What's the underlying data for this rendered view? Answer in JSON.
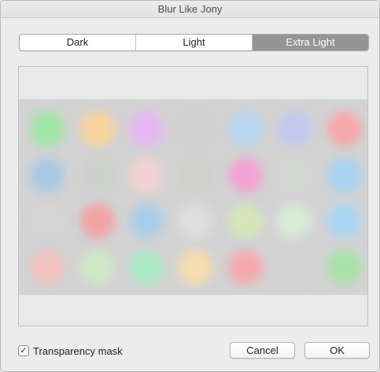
{
  "window": {
    "title": "Blur Like Jony"
  },
  "segments": [
    {
      "label": "Dark",
      "selected": false
    },
    {
      "label": "Light",
      "selected": false
    },
    {
      "label": "Extra Light",
      "selected": true
    }
  ],
  "colors": {
    "selected_segment": "#949494",
    "preview_background": "#d3d3d3",
    "icon_colors": [
      "#9ee6a4",
      "#f7d49a",
      "#e6b7f3",
      "#d0d0d0",
      "#b6d6f0",
      "#c1c9ef",
      "#f6a7a9",
      "#a9c9e4",
      "#ccd0cc",
      "#f3d1d1",
      "#cfd0c9",
      "#f2a3d1",
      "#d2d7d2",
      "#a6d2f0",
      "#d4d4d4",
      "#f2a3a6",
      "#a9cde8",
      "#dedede",
      "#d5e6b9",
      "#d9ebd7",
      "#a9d6f3",
      "#f3c1c1",
      "#cde9c4",
      "#a9eac6",
      "#f6dcae",
      "#f3a9ad",
      "#d3d3d3",
      "#a8e1a8"
    ]
  },
  "footer": {
    "transparency_mask": {
      "label": "Transparency mask",
      "checked": true,
      "check_glyph": "✓"
    },
    "cancel_label": "Cancel",
    "ok_label": "OK"
  }
}
